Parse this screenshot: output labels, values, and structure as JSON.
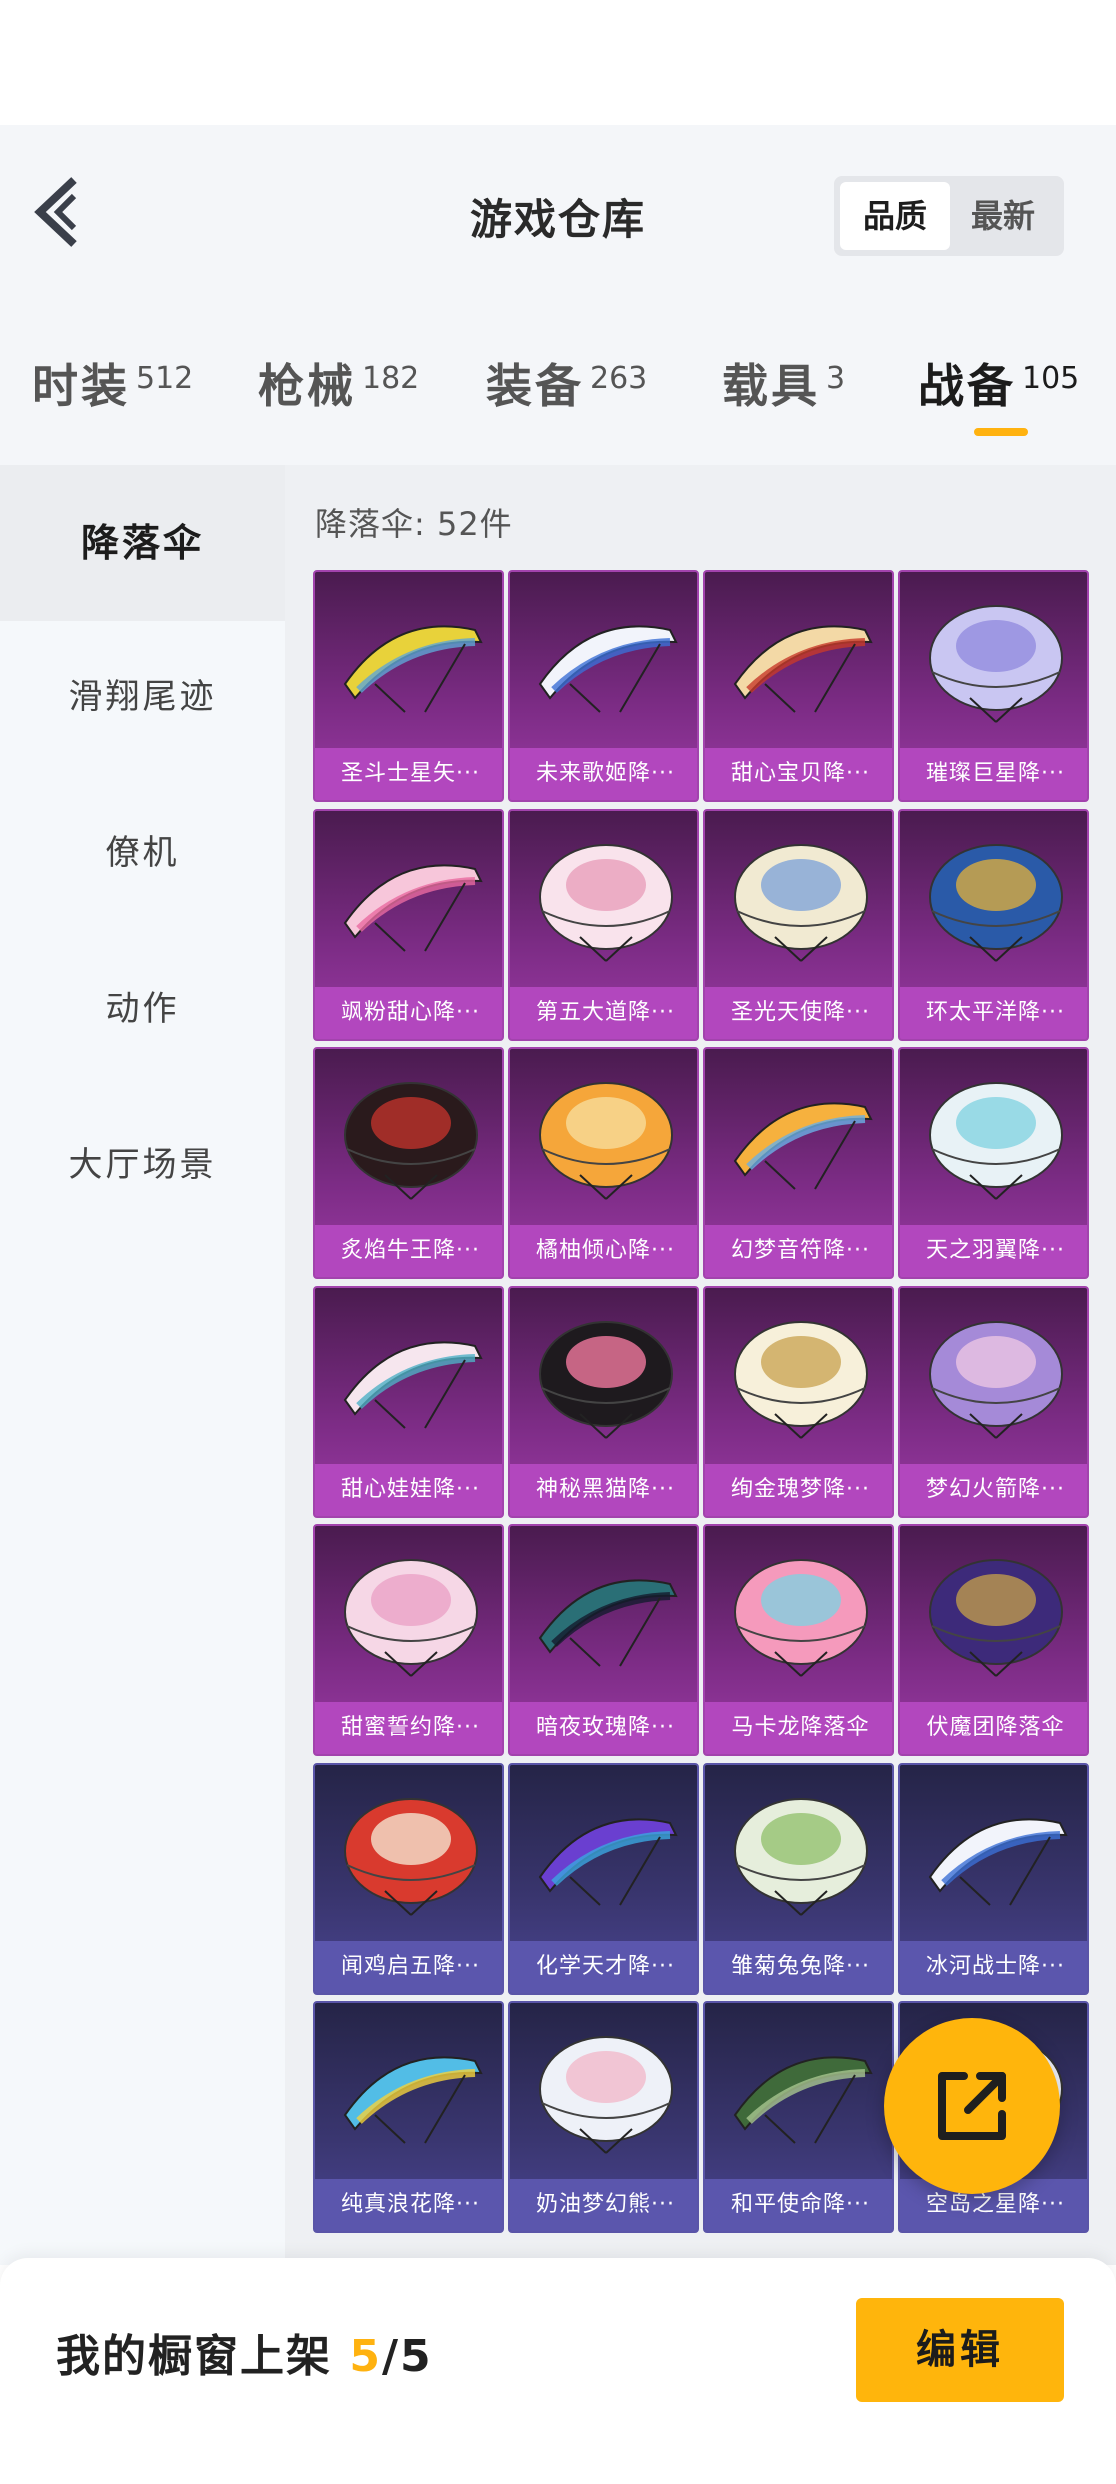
{
  "header": {
    "title": "游戏仓库",
    "sort": [
      "品质",
      "最新"
    ]
  },
  "tabs": [
    {
      "label": "时装",
      "count": "512"
    },
    {
      "label": "枪械",
      "count": "182"
    },
    {
      "label": "装备",
      "count": "263"
    },
    {
      "label": "载具",
      "count": "3"
    },
    {
      "label": "战备",
      "count": "105"
    }
  ],
  "sidebar": {
    "items": [
      "降落伞",
      "滑翔尾迹",
      "僚机",
      "动作",
      "大厅场景"
    ]
  },
  "content": {
    "count_label": "降落伞: 52件",
    "items": [
      {
        "name": "圣斗士星矢···",
        "tier": "purple",
        "icon": "golden-glider-parachute"
      },
      {
        "name": "未来歌姬降···",
        "tier": "purple",
        "icon": "blue-white-glider-parachute"
      },
      {
        "name": "甜心宝贝降···",
        "tier": "purple",
        "icon": "cartoon-glider-parachute"
      },
      {
        "name": "璀璨巨星降···",
        "tier": "purple",
        "icon": "lavender-dome-parachute"
      },
      {
        "name": "飒粉甜心降···",
        "tier": "purple",
        "icon": "pink-glider-parachute"
      },
      {
        "name": "第五大道降···",
        "tier": "purple",
        "icon": "pink-plaid-dome-parachute"
      },
      {
        "name": "圣光天使降···",
        "tier": "purple",
        "icon": "angel-dome-parachute"
      },
      {
        "name": "环太平洋降···",
        "tier": "purple",
        "icon": "blue-gold-dome-parachute"
      },
      {
        "name": "炙焰牛王降···",
        "tier": "purple",
        "icon": "red-black-dome-parachute"
      },
      {
        "name": "橘柚倾心降···",
        "tier": "purple",
        "icon": "orange-dome-parachute"
      },
      {
        "name": "幻梦音符降···",
        "tier": "purple",
        "icon": "orange-glider-parachute"
      },
      {
        "name": "天之羽翼降···",
        "tier": "purple",
        "icon": "cyan-dome-parachute"
      },
      {
        "name": "甜心娃娃降···",
        "tier": "purple",
        "icon": "doll-glider-parachute"
      },
      {
        "name": "神秘黑猫降···",
        "tier": "purple",
        "icon": "black-cat-parachute"
      },
      {
        "name": "绚金瑰梦降···",
        "tier": "purple",
        "icon": "gold-white-dome-parachute"
      },
      {
        "name": "梦幻火箭降···",
        "tier": "purple",
        "icon": "purple-rocket-dome-parachute"
      },
      {
        "name": "甜蜜誓约降···",
        "tier": "purple",
        "icon": "pink-lace-dome-parachute"
      },
      {
        "name": "暗夜玫瑰降···",
        "tier": "purple",
        "icon": "dark-teal-glider-parachute"
      },
      {
        "name": "马卡龙降落伞",
        "tier": "purple",
        "icon": "macaron-dome-parachute"
      },
      {
        "name": "伏魔团降落伞",
        "tier": "purple",
        "icon": "dark-purple-dome-parachute"
      },
      {
        "name": "闻鸡启五降···",
        "tier": "blue",
        "icon": "red-rooster-parachute"
      },
      {
        "name": "化学天才降···",
        "tier": "blue",
        "icon": "purple-glider-parachute"
      },
      {
        "name": "雏菊兔兔降···",
        "tier": "blue",
        "icon": "green-bunny-dome-parachute"
      },
      {
        "name": "冰河战士降···",
        "tier": "blue",
        "icon": "blue-white-glider-parachute"
      },
      {
        "name": "纯真浪花降···",
        "tier": "blue",
        "icon": "wave-glider-parachute"
      },
      {
        "name": "奶油梦幻熊···",
        "tier": "blue",
        "icon": "cream-bear-dome-parachute"
      },
      {
        "name": "和平使命降···",
        "tier": "blue",
        "icon": "camo-glider-parachute"
      },
      {
        "name": "空岛之星降···",
        "tier": "blue",
        "icon": "sky-dome-parachute"
      }
    ]
  },
  "bottom": {
    "label": "我的橱窗上架",
    "current": "5",
    "separator": "/",
    "total": "5",
    "edit_label": "编辑"
  },
  "colors": {
    "accent": "#ffb50c",
    "purple_tier": "#b247be",
    "blue_tier": "#5b56ad"
  }
}
